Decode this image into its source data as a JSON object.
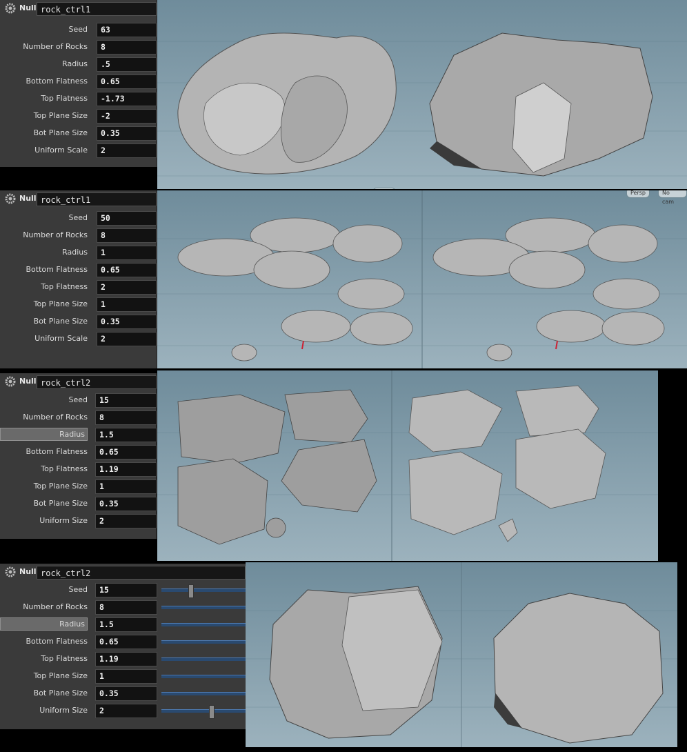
{
  "panel_kind": "Null",
  "panels": [
    {
      "name": "rock_ctrl1",
      "params": [
        {
          "label": "Seed",
          "value": "63"
        },
        {
          "label": "Number of Rocks",
          "value": "8"
        },
        {
          "label": "Radius",
          "value": ".5"
        },
        {
          "label": "Bottom Flatness",
          "value": "0.65"
        },
        {
          "label": "Top Flatness",
          "value": "-1.73"
        },
        {
          "label": "Top Plane Size",
          "value": "-2"
        },
        {
          "label": "Bot Plane Size",
          "value": "0.35"
        },
        {
          "label": "Uniform Scale",
          "value": "2"
        }
      ]
    },
    {
      "name": "rock_ctrl1",
      "params": [
        {
          "label": "Seed",
          "value": "50"
        },
        {
          "label": "Number of Rocks",
          "value": "8"
        },
        {
          "label": "Radius",
          "value": "1"
        },
        {
          "label": "Bottom Flatness",
          "value": "0.65"
        },
        {
          "label": "Top Flatness",
          "value": "2"
        },
        {
          "label": "Top Plane Size",
          "value": "1"
        },
        {
          "label": "Bot Plane Size",
          "value": "0.35"
        },
        {
          "label": "Uniform Scale",
          "value": "2"
        }
      ]
    },
    {
      "name": "rock_ctrl2",
      "params": [
        {
          "label": "Seed",
          "value": "15"
        },
        {
          "label": "Number of Rocks",
          "value": "8"
        },
        {
          "label": "Radius",
          "value": "1.5"
        },
        {
          "label": "Bottom Flatness",
          "value": "0.65"
        },
        {
          "label": "Top Flatness",
          "value": "1.19"
        },
        {
          "label": "Top Plane Size",
          "value": "1"
        },
        {
          "label": "Bot Plane Size",
          "value": "0.35"
        },
        {
          "label": "Uniform Size",
          "value": "2"
        }
      ]
    },
    {
      "name": "rock_ctrl2",
      "params": [
        {
          "label": "Seed",
          "value": "15",
          "slider": 0.42
        },
        {
          "label": "Number of Rocks",
          "value": "8",
          "slider": 0
        },
        {
          "label": "Radius",
          "value": "1.5",
          "slider": 1
        },
        {
          "label": "Bottom Flatness",
          "value": "0.65",
          "slider": 1
        },
        {
          "label": "Top Flatness",
          "value": "1.19",
          "slider": 1
        },
        {
          "label": "Top Plane Size",
          "value": "1",
          "slider": 1
        },
        {
          "label": "Bot Plane Size",
          "value": "0.35",
          "slider": 1
        },
        {
          "label": "Uniform Size",
          "value": "2",
          "slider": 0.75
        }
      ]
    }
  ],
  "viewport_menus": {
    "persp": "Persp",
    "cam": "No cam"
  },
  "colors": {
    "panel_bg": "#3a3a3a",
    "field_bg": "#121212",
    "viewport_top": "#6f8c9b",
    "viewport_bottom": "#9cb2bd",
    "slider_fill": "#2a4a70"
  }
}
